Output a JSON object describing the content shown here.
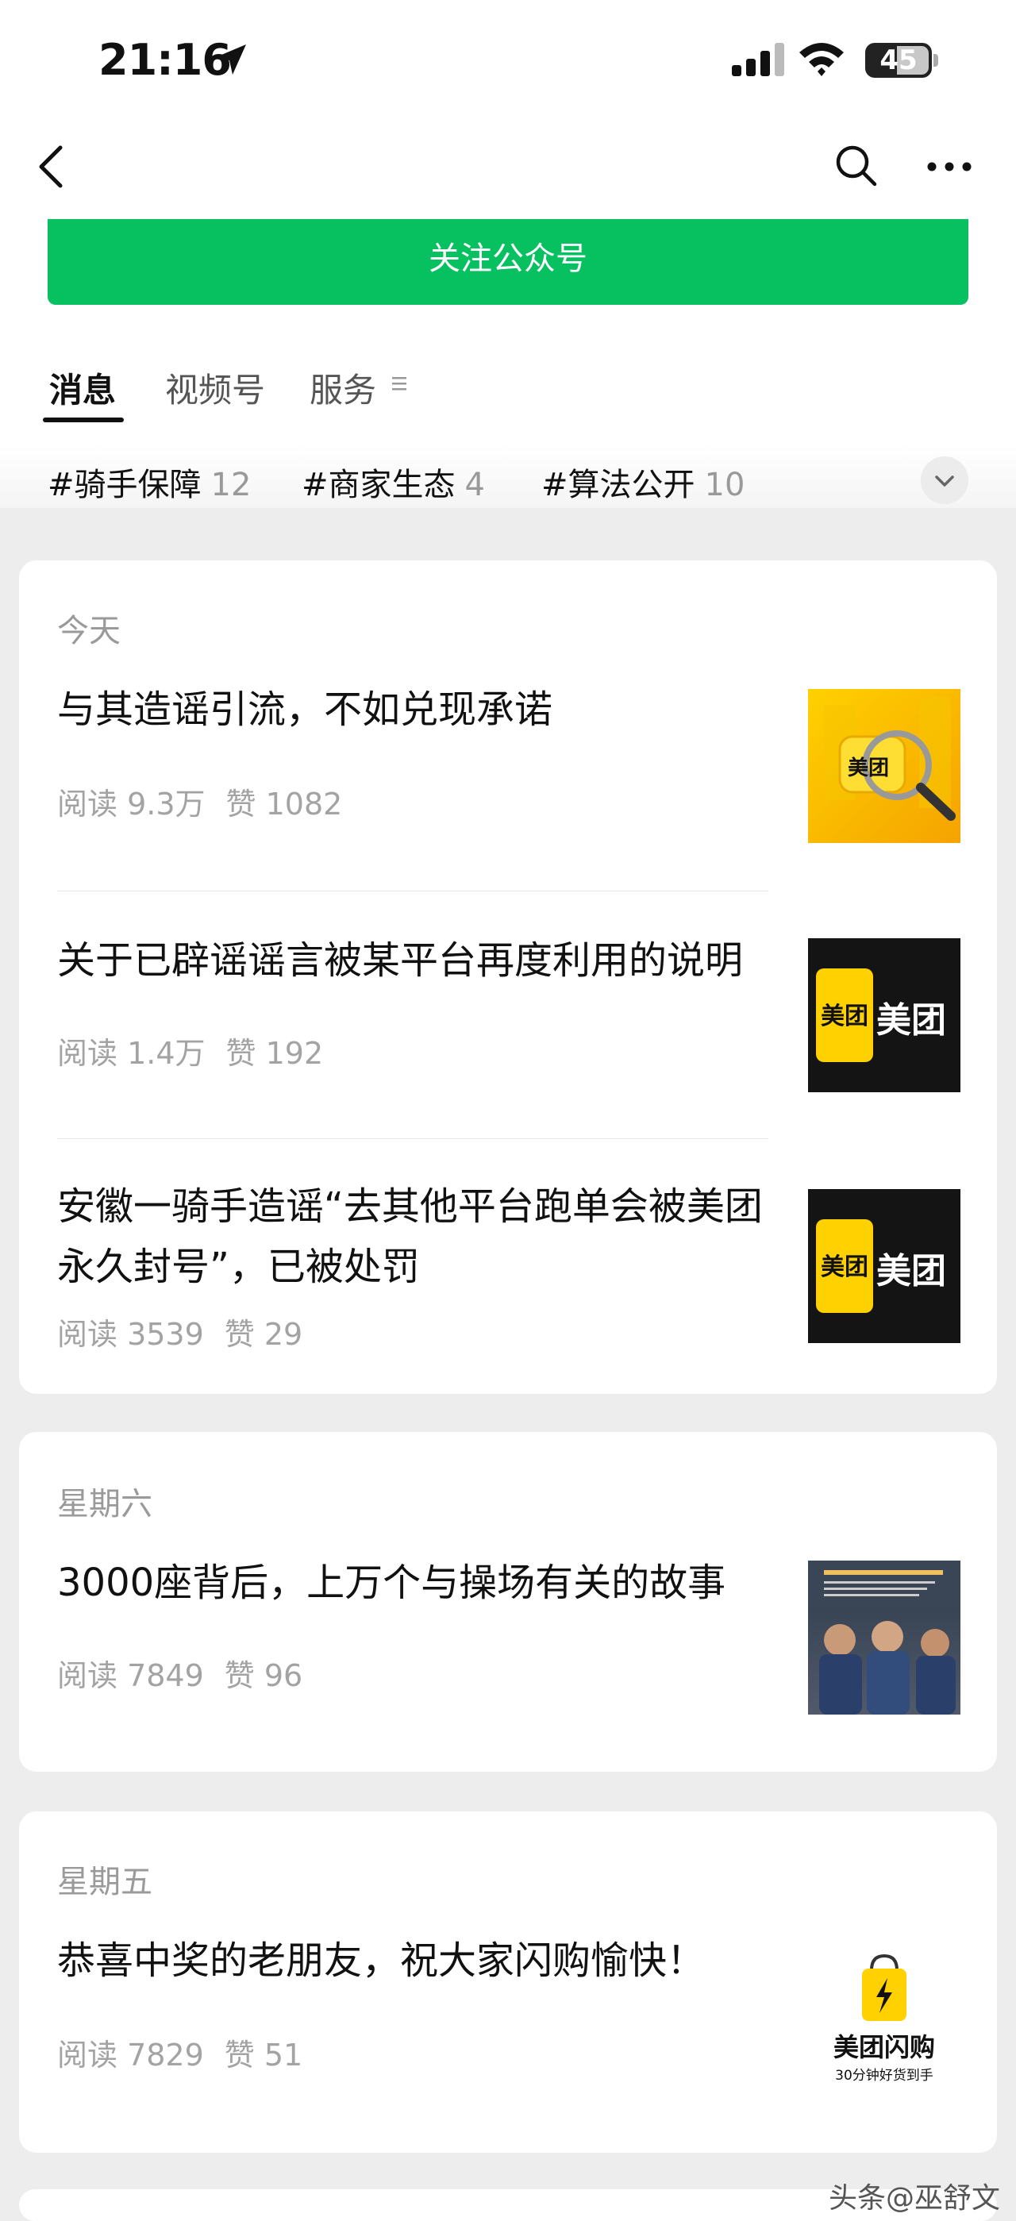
{
  "status": {
    "time": "21:16",
    "battery": "45"
  },
  "follow_label": "关注公众号",
  "tabs": [
    {
      "label": "消息"
    },
    {
      "label": "视频号"
    },
    {
      "label": "服务"
    }
  ],
  "topics": [
    {
      "name": "#骑手保障",
      "count": "12"
    },
    {
      "name": "#商家生态",
      "count": "4"
    },
    {
      "name": "#算法公开",
      "count": "10"
    }
  ],
  "groups": [
    {
      "day": "今天",
      "articles": [
        {
          "title": "与其造谣引流，不如兑现承诺",
          "reads": "阅读 9.3万",
          "likes": "赞 1082",
          "thumb_text": "美团"
        },
        {
          "title": "关于已辟谣谣言被某平台再度利用的说明",
          "reads": "阅读 1.4万",
          "likes": "赞 192",
          "thumb_text": "美团"
        },
        {
          "title": "安徽一骑手造谣“去其他平台跑单会被美团永久封号”，已被处罚",
          "reads": "阅读 3539",
          "likes": "赞 29",
          "thumb_text": "美团"
        }
      ]
    },
    {
      "day": "星期六",
      "articles": [
        {
          "title": "3000座背后，上万个与操场有关的故事",
          "reads": "阅读 7849",
          "likes": "赞 96"
        }
      ]
    },
    {
      "day": "星期五",
      "articles": [
        {
          "title": "恭喜中奖的老朋友，祝大家闪购愉快！",
          "reads": "阅读 7829",
          "likes": "赞 51",
          "thumb_text": "美团闪购",
          "thumb_sub": "30分钟好货到手"
        }
      ]
    }
  ],
  "watermark": "头条@巫舒文",
  "colors": {
    "accent_green": "#07c160",
    "meituan_yellow": "#ffd100"
  }
}
